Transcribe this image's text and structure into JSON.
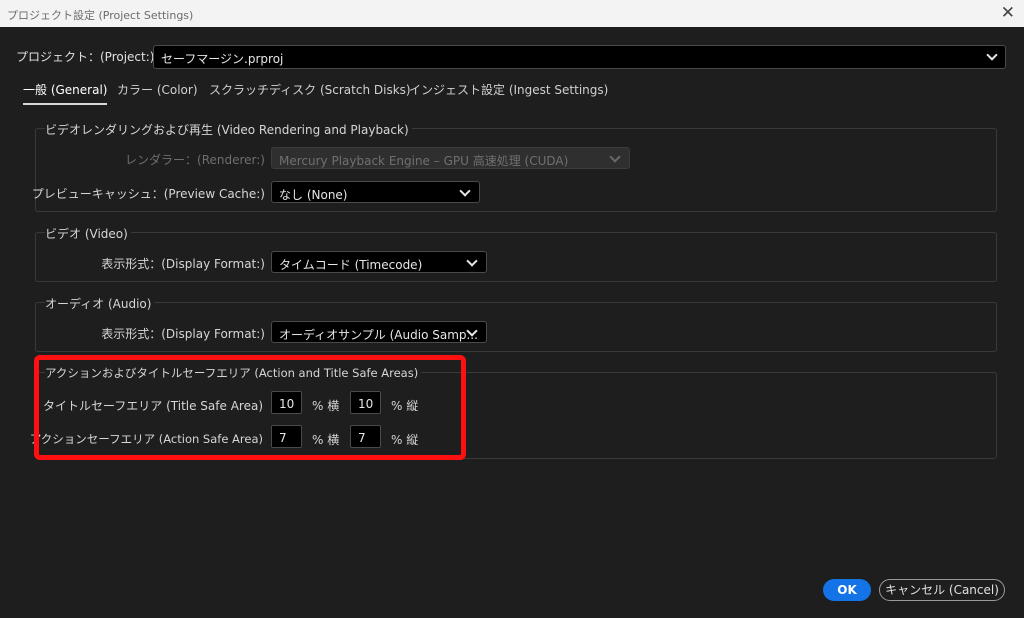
{
  "window": {
    "title": "プロジェクト設定 (Project Settings)",
    "close_glyph": "✕"
  },
  "project": {
    "label": "プロジェクト：(Project:)",
    "value": "セーフマージン.prproj"
  },
  "tabs": [
    {
      "label": "一般 (General)",
      "active": true
    },
    {
      "label": "カラー (Color)",
      "active": false
    },
    {
      "label": "スクラッチディスク (Scratch Disks)",
      "active": false
    },
    {
      "label": "インジェスト設定 (Ingest Settings)",
      "active": false
    }
  ],
  "video_rendering": {
    "title": "ビデオレンダリングおよび再生 (Video Rendering and Playback)",
    "renderer_label": "レンダラー：(Renderer:)",
    "renderer_value": "Mercury Playback Engine – GPU 高速処理 (CUDA)",
    "preview_cache_label": "プレビューキャッシュ：(Preview Cache:)",
    "preview_cache_value": "なし (None)"
  },
  "video": {
    "title": "ビデオ (Video)",
    "display_format_label": "表示形式：(Display Format:)",
    "display_format_value": "タイムコード (Timecode)"
  },
  "audio": {
    "title": "オーディオ (Audio)",
    "display_format_label": "表示形式：(Display Format:)",
    "display_format_value": "オーディオサンプル (Audio Samp..."
  },
  "safe_areas": {
    "title": "アクションおよびタイトルセーフエリア (Action and Title Safe Areas)",
    "title_safe_label": "タイトルセーフエリア (Title Safe Area)",
    "title_safe_h": "10",
    "title_safe_v": "10",
    "action_safe_label": "アクションセーフエリア (Action Safe Area)",
    "action_safe_h": "7",
    "action_safe_v": "7",
    "unit_h": "% 横",
    "unit_v": "% 縦",
    "highlight_color": "#ff1010"
  },
  "buttons": {
    "ok": "OK",
    "cancel": "キャンセル (Cancel)"
  },
  "colors": {
    "accent": "#1473e6",
    "background": "#1e1e1e"
  }
}
